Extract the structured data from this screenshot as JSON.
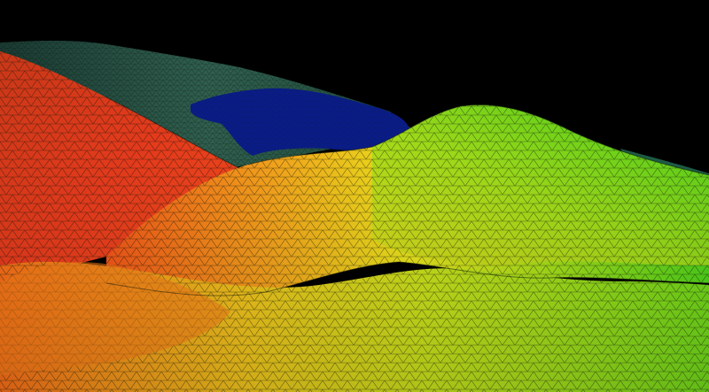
{
  "scene": {
    "background": "#000000",
    "wire_color": "#0a1208",
    "palette": {
      "red": "#e3301c",
      "orange": "#f0641a",
      "yellow": "#e9e41b",
      "yellow_green": "#b8e21a",
      "green": "#59d51a",
      "dark_teal": "#1d6a4a",
      "gray_green": "#3f6a56",
      "water_blue": "#0a1d8a"
    }
  }
}
